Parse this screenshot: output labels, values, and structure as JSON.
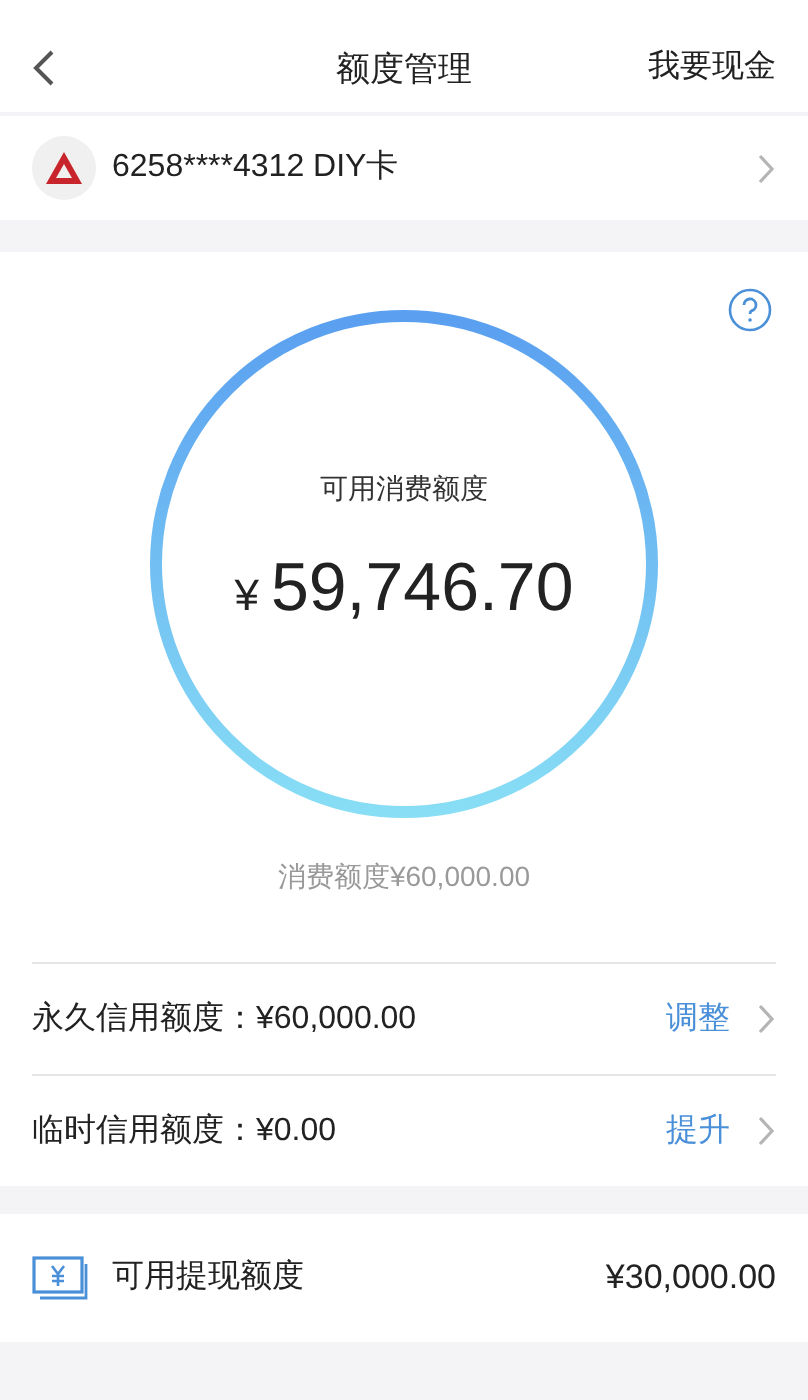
{
  "nav": {
    "title": "额度管理",
    "action": "我要现金"
  },
  "card": {
    "number": "6258****4312 DIY卡"
  },
  "gauge": {
    "label": "可用消费额度",
    "currency": "¥",
    "amount": "59,746.70",
    "total": "消费额度¥60,000.00"
  },
  "limits": [
    {
      "label": "永久信用额度：¥60,000.00",
      "action": "调整"
    },
    {
      "label": "临时信用额度：¥0.00",
      "action": "提升"
    }
  ],
  "cash": {
    "label": "可用提现额度",
    "amount": "¥30,000.00"
  }
}
